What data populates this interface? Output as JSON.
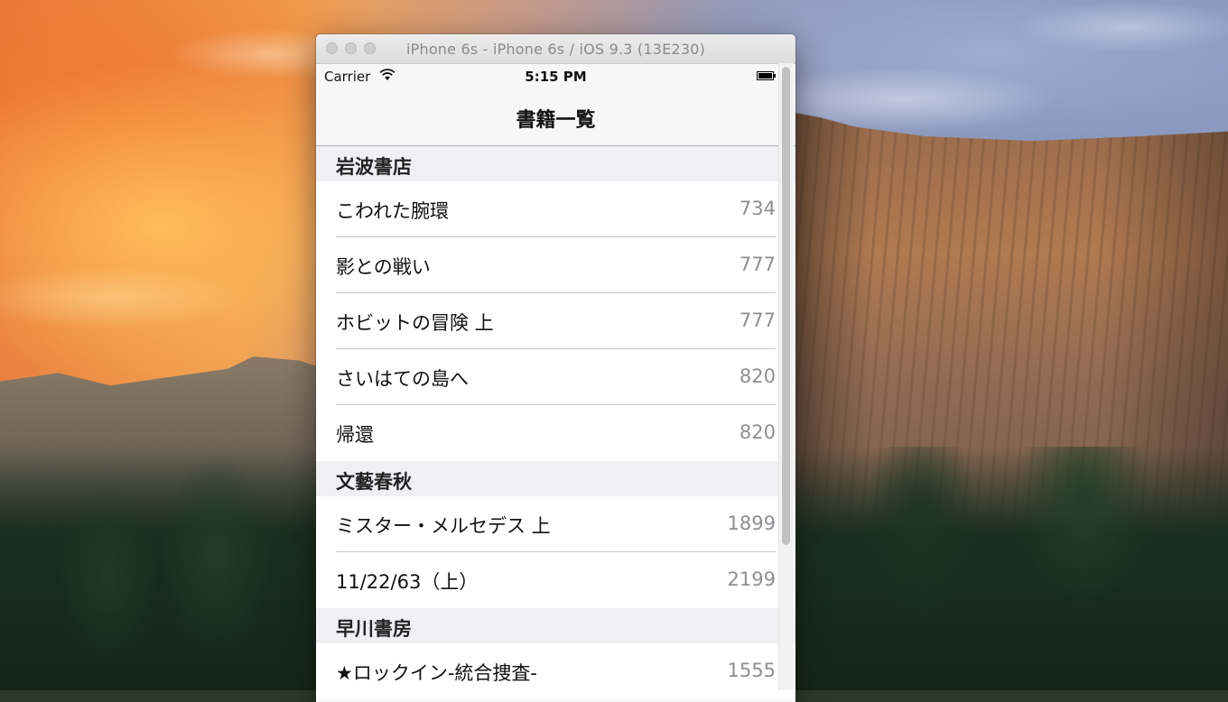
{
  "window": {
    "title": "iPhone 6s - iPhone 6s / iOS 9.3 (13E230)"
  },
  "status_bar": {
    "carrier": "Carrier",
    "time": "5:15 PM",
    "icons": {
      "signal": "wifi-icon",
      "battery": "battery-icon"
    }
  },
  "nav_bar": {
    "title": "書籍一覧"
  },
  "sections": [
    {
      "header": "岩波書店",
      "rows": [
        {
          "title": "こわれた腕環",
          "detail": "734"
        },
        {
          "title": "影との戦い",
          "detail": "777"
        },
        {
          "title": "ホビットの冒険 上",
          "detail": "777"
        },
        {
          "title": "さいはての島へ",
          "detail": "820"
        },
        {
          "title": "帰還",
          "detail": "820"
        }
      ]
    },
    {
      "header": "文藝春秋",
      "rows": [
        {
          "title": "ミスター・メルセデス 上",
          "detail": "1899"
        },
        {
          "title": "11/22/63（上）",
          "detail": "2199"
        }
      ]
    },
    {
      "header": "早川書房",
      "rows": [
        {
          "title": "★ロックイン-統合捜査-",
          "detail": "1555"
        }
      ]
    }
  ],
  "colors": {
    "nav_background": "#f7f7f7",
    "section_header_background": "#efeff4",
    "detail_text": "#8e8e93",
    "separator": "#c8c7cc"
  }
}
